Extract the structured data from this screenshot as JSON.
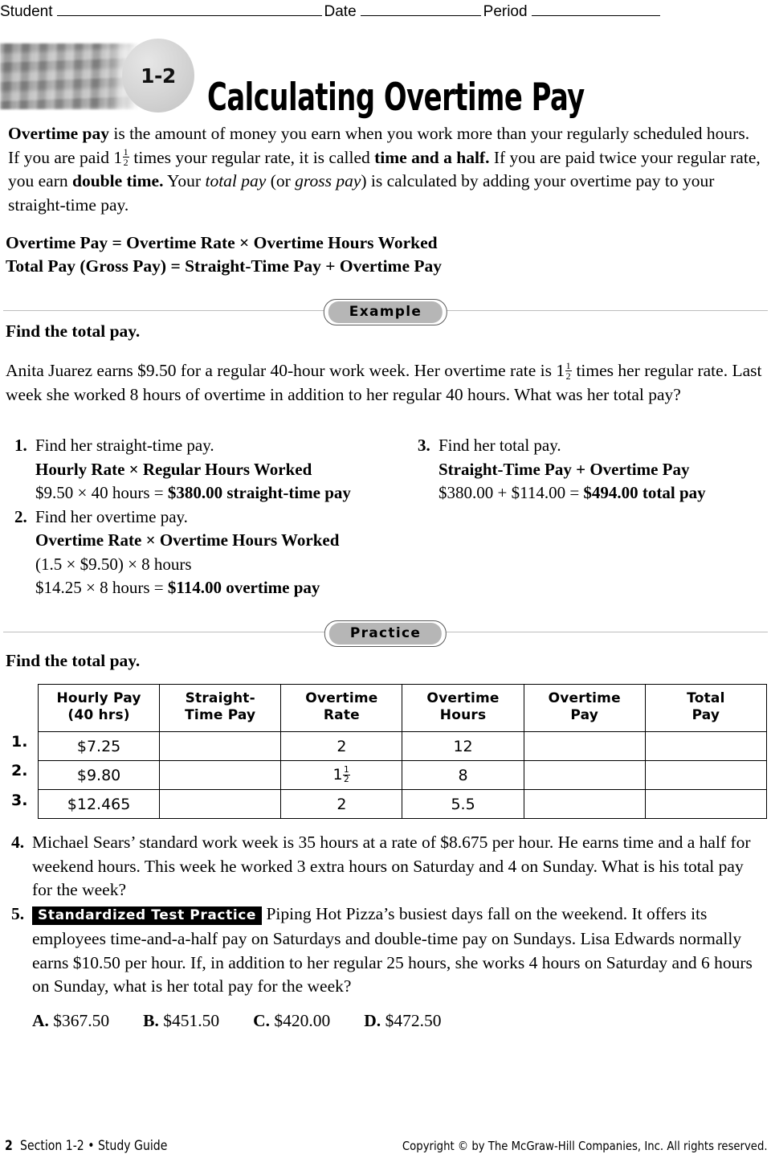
{
  "header": {
    "student_label": "Student",
    "date_label": "Date",
    "period_label": "Period"
  },
  "banner": {
    "lesson_number": "1-2",
    "title": "Calculating Overtime Pay",
    "photo_alt": "calculator-photo"
  },
  "intro": {
    "term_overtime_pay": "Overtime pay",
    "part1": " is the amount of money you earn when you work more than your regularly scheduled hours. If you are paid 1",
    "frac_whole": "1",
    "frac_num": "1",
    "frac_den": "2",
    "part2": " times your regular rate, it is called ",
    "term_time_and_a_half": "time and a half.",
    "part3": " If you are paid twice your regular rate, you earn ",
    "term_double_time": "double time.",
    "part4": " Your ",
    "em_total_pay": "total pay",
    "part5": " (or ",
    "em_gross_pay": "gross pay",
    "part6": ") is calculated by adding your overtime pay to your straight-time pay."
  },
  "formulas": {
    "line1": "Overtime Pay = Overtime Rate × Overtime Hours Worked",
    "line2": "Total Pay (Gross Pay) = Straight-Time Pay + Overtime Pay"
  },
  "example": {
    "badge": "Example",
    "lead": "Find the total pay.",
    "problem_a": "Anita Juarez earns $9.50 for a regular 40-hour work week. Her overtime rate is 1",
    "frac_num": "1",
    "frac_den": "2",
    "problem_b": " times her regular rate. Last week she worked 8 hours of overtime in addition to her regular 40 hours. What was her total pay?",
    "steps": [
      {
        "num": "1.",
        "prompt": "Find her straight-time pay.",
        "formula": "Hourly Rate × Regular Hours Worked",
        "work": "$9.50 × 40 hours = ",
        "answer": "$380.00 straight-time pay"
      },
      {
        "num": "2.",
        "prompt": "Find her overtime pay.",
        "formula": "Overtime Rate × Overtime Hours Worked",
        "work_line1": "(1.5 × $9.50) × 8 hours",
        "work": "$14.25 × 8 hours = ",
        "answer": "$114.00 overtime pay"
      },
      {
        "num": "3.",
        "prompt": "Find her total pay.",
        "formula": "Straight-Time Pay + Overtime Pay",
        "work": "$380.00 + $114.00 = ",
        "answer": "$494.00 total pay"
      }
    ]
  },
  "practice": {
    "badge": "Practice",
    "lead": "Find the total pay.",
    "table": {
      "columns": [
        "Hourly Pay\n(40 hrs)",
        "Straight-\nTime Pay",
        "Overtime\nRate",
        "Overtime\nHours",
        "Overtime\nPay",
        "Total\nPay"
      ],
      "columns_split": [
        [
          "Hourly Pay",
          "(40 hrs)"
        ],
        [
          "Straight-",
          "Time Pay"
        ],
        [
          "Overtime",
          "Rate"
        ],
        [
          "Overtime",
          "Hours"
        ],
        [
          "Overtime",
          "Pay"
        ],
        [
          "Total",
          "Pay"
        ]
      ],
      "row_numbers": [
        "1.",
        "2.",
        "3."
      ],
      "rows": [
        {
          "hourly_pay": "$7.25",
          "straight_time_pay": "",
          "overtime_rate": "2",
          "overtime_rate_frac": null,
          "overtime_hours": "12",
          "overtime_pay": "",
          "total_pay": ""
        },
        {
          "hourly_pay": "$9.80",
          "straight_time_pay": "",
          "overtime_rate": "1",
          "overtime_rate_frac": {
            "num": "1",
            "den": "2"
          },
          "overtime_hours": "8",
          "overtime_pay": "",
          "total_pay": ""
        },
        {
          "hourly_pay": "$12.465",
          "straight_time_pay": "",
          "overtime_rate": "2",
          "overtime_rate_frac": null,
          "overtime_hours": "5.5",
          "overtime_pay": "",
          "total_pay": ""
        }
      ]
    },
    "questions": [
      {
        "num": "4.",
        "text": "Michael Sears’ standard work week is 35 hours at a rate of $8.675 per hour. He earns time and a half for weekend hours. This week he worked 3 extra hours on Saturday and 4 on Sunday. What is his total pay for the week?"
      },
      {
        "num": "5.",
        "label": "Standardized Test Practice",
        "text": " Piping Hot Pizza’s busiest days fall on the weekend. It offers its employees time-and-a-half pay on Saturdays and double-time pay on Sundays. Lisa Edwards normally earns $10.50 per hour. If, in addition to her regular 25 hours, she works 4 hours on Saturday and 6 hours on Sunday, what is her total pay for the week?",
        "choices": [
          {
            "letter": "A.",
            "value": "$367.50"
          },
          {
            "letter": "B.",
            "value": "$451.50"
          },
          {
            "letter": "C.",
            "value": "$420.00"
          },
          {
            "letter": "D.",
            "value": "$472.50"
          }
        ]
      }
    ]
  },
  "footer": {
    "page_number": "2",
    "section_text": "Section 1-2 • Study Guide",
    "copyright": "Copyright © by The McGraw-Hill Companies, Inc. All rights reserved."
  },
  "colors": {
    "pill_fill": "#b6b6b6",
    "pill_border": "#5a5a5a",
    "rule": "#bdbdbd",
    "badge_circle": "#d2d2d2",
    "text": "#000000"
  }
}
